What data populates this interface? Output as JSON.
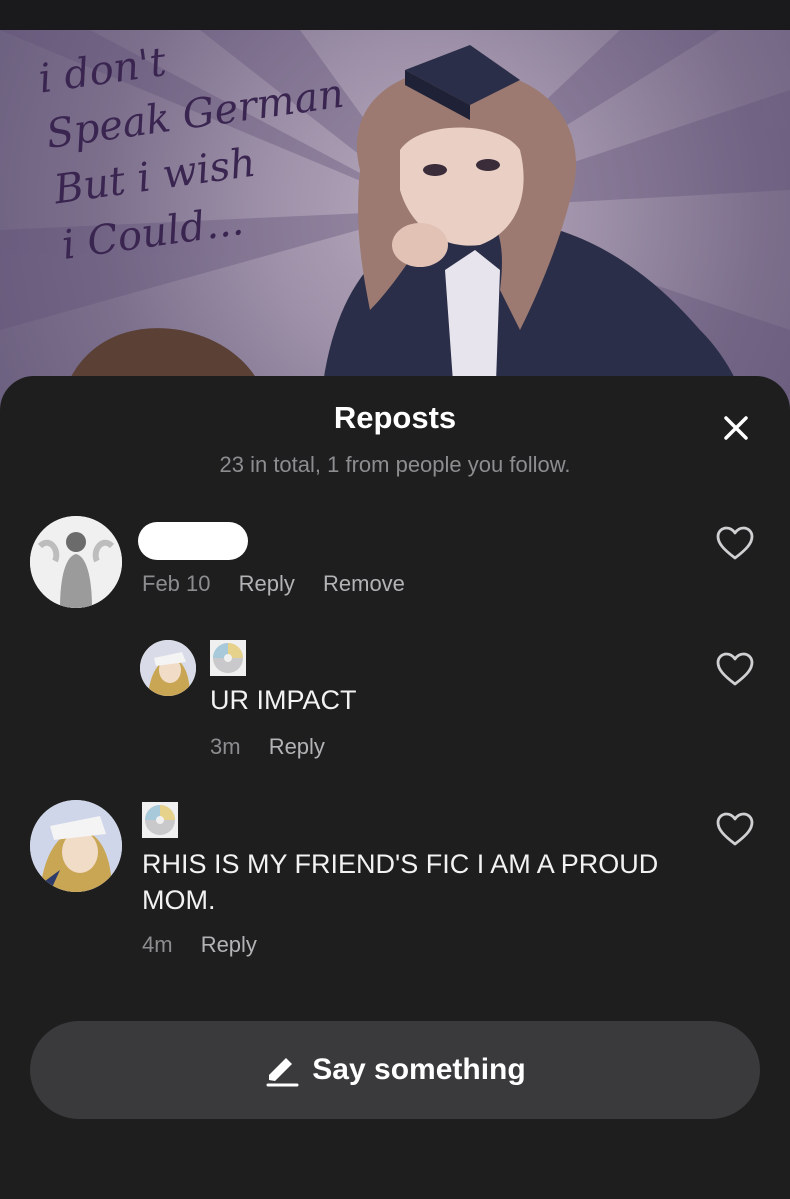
{
  "artwork": {
    "caption": "i don't\nSpeak German\nBut i wish\ni Could..."
  },
  "sheet": {
    "title": "Reposts",
    "subtitle": "23 in total, 1 from people you follow."
  },
  "comments": [
    {
      "time": "Feb 10",
      "reply_label": "Reply",
      "remove_label": "Remove"
    },
    {
      "text": "UR IMPACT",
      "time": "3m",
      "reply_label": "Reply"
    },
    {
      "text": "RHIS IS MY FRIEND'S FIC I AM A PROUD MOM.",
      "time": "4m",
      "reply_label": "Reply"
    }
  ],
  "composer": {
    "placeholder": "Say something"
  },
  "colors": {
    "background": "#1e1e1f",
    "muted_text": "#8d8d90",
    "action_text": "#b3b3b6",
    "composer_bg": "#3a3a3c"
  },
  "icons": {
    "close": "close-icon",
    "like": "heart-icon",
    "badge": "cd-icon",
    "compose": "pencil-icon"
  }
}
